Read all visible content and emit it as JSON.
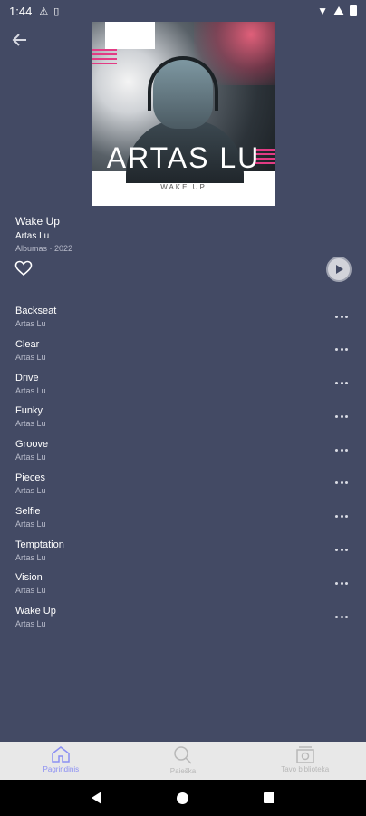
{
  "status_bar": {
    "time": "1:44"
  },
  "album": {
    "art_title": "ARTAS LU",
    "art_subtitle": "WAKE UP",
    "title": "Wake Up",
    "artist": "Artas Lu",
    "meta": "Albumas · 2022"
  },
  "tracks": [
    {
      "title": "Backseat",
      "artist": "Artas Lu"
    },
    {
      "title": "Clear",
      "artist": "Artas Lu"
    },
    {
      "title": "Drive",
      "artist": "Artas Lu"
    },
    {
      "title": "Funky",
      "artist": "Artas Lu"
    },
    {
      "title": "Groove",
      "artist": "Artas Lu"
    },
    {
      "title": "Pieces",
      "artist": "Artas Lu"
    },
    {
      "title": "Selfie",
      "artist": "Artas Lu"
    },
    {
      "title": "Temptation",
      "artist": "Artas Lu"
    },
    {
      "title": "Vision",
      "artist": "Artas Lu"
    },
    {
      "title": "Wake Up",
      "artist": "Artas Lu"
    }
  ],
  "bottom_nav": {
    "items": [
      {
        "label": "Pagrindinis",
        "icon": "home-icon",
        "active": true
      },
      {
        "label": "Paieška",
        "icon": "search-icon",
        "active": false
      },
      {
        "label": "Tavo biblioteka",
        "icon": "library-icon",
        "active": false
      }
    ]
  },
  "colors": {
    "background": "#434a64",
    "accent": "#8b8ff3",
    "art_stripe": "#e23b84"
  }
}
